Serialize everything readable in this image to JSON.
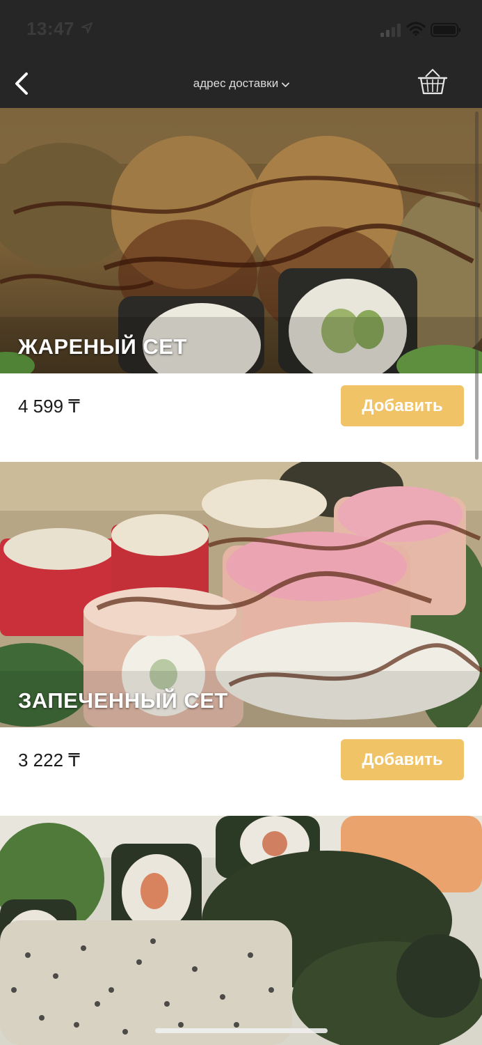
{
  "status_bar": {
    "time": "13:47"
  },
  "nav": {
    "address_label": "адрес доставки"
  },
  "products": [
    {
      "title": "ЖАРЕНЫЙ СЕТ",
      "price": "4 599 ₸",
      "button_label": "Добавить"
    },
    {
      "title": "ЗАПЕЧЕННЫЙ СЕТ",
      "price": "3 222 ₸",
      "button_label": "Добавить"
    }
  ],
  "colors": {
    "header_bg": "#262626",
    "accent_button": "#f0c466",
    "button_text": "#ffffff",
    "price_text": "#1a1a1a"
  },
  "icons": [
    "location-arrow-icon",
    "signal-icon",
    "wifi-icon",
    "battery-icon",
    "back-chevron-icon",
    "chevron-down-icon",
    "basket-icon"
  ]
}
